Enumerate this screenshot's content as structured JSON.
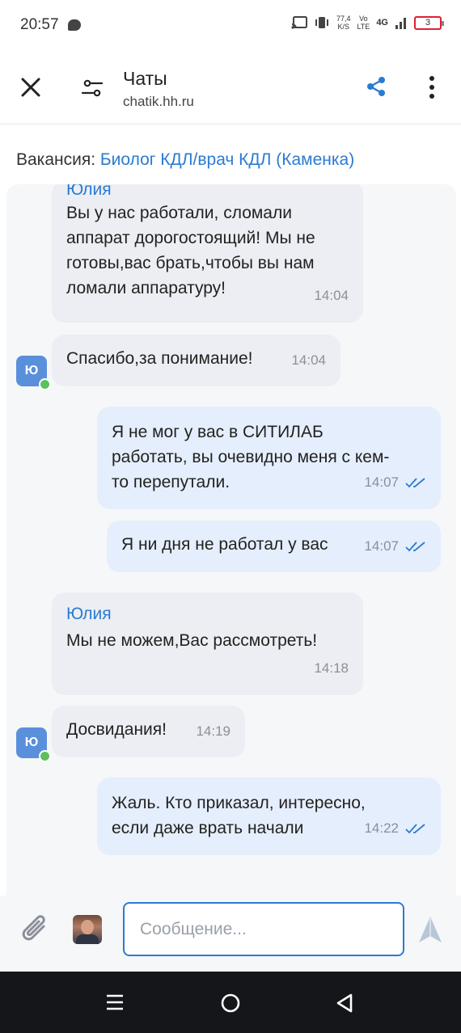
{
  "status_bar": {
    "time": "20:57",
    "net_speed_value": "77,4",
    "net_speed_unit": "K/S",
    "volte_top": "Vo",
    "volte_bottom": "LTE",
    "network": "4G",
    "battery": "3"
  },
  "header": {
    "title": "Чаты",
    "subtitle": "chatik.hh.ru",
    "icons": [
      "close-icon",
      "filter-icon",
      "share-icon",
      "more-icon"
    ]
  },
  "vacancy": {
    "label": "Вакансия: ",
    "link": "Биолог КДЛ/врач КДЛ (Каменка)"
  },
  "messages": [
    {
      "author": "Юлия",
      "line1": "Вы у нас работали, сломали",
      "line2": "аппарат дорогостоящий! Мы не",
      "line3": "готовы,вас брать,чтобы вы нам",
      "line4": "ломали аппаратуру!",
      "time": "14:04"
    },
    {
      "text": "Спасибо,за понимание!",
      "time": "14:04",
      "avatar": "Ю"
    },
    {
      "line1": "Я не мог у вас в СИТИЛАБ",
      "line2": "работать, вы очевидно меня с кем-",
      "line3": "то перепутали.",
      "time": "14:07"
    },
    {
      "text": "Я ни дня не работал у вас",
      "time": "14:07"
    },
    {
      "author": "Юлия",
      "text": "Мы не можем,Вас рассмотреть!",
      "time": "14:18"
    },
    {
      "text": "Досвидания!",
      "time": "14:19",
      "avatar": "Ю"
    },
    {
      "line1": "Жаль. Кто приказал, интересно,",
      "line2": "если даже врать начали",
      "time": "14:22"
    }
  ],
  "composer": {
    "placeholder": "Сообщение..."
  },
  "colors": {
    "accent": "#2b7bd1",
    "incoming_bubble": "#eceef3",
    "outgoing_bubble": "#e5eefc",
    "online_dot": "#5bc25b"
  }
}
